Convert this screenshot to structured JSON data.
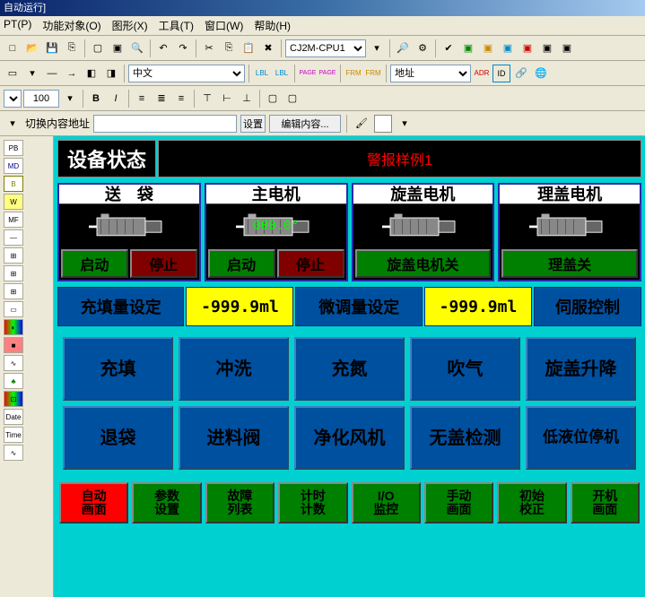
{
  "window_title": "自动运行]",
  "menu": {
    "pt": "PT(P)",
    "func_obj": "功能对象(O)",
    "graphic": "图形(X)",
    "tool": "工具(T)",
    "window": "窗口(W)",
    "help": "帮助(H)"
  },
  "toolbar1": {
    "cpu_model": "CJ2M-CPU1"
  },
  "toolbar2": {
    "language": "中文",
    "addr_label": "地址"
  },
  "toolbar3": {
    "font_size": "100",
    "bold": "B",
    "italic": "I"
  },
  "addr_bar": {
    "label": "切换内容地址",
    "set_btn": "设置",
    "edit_btn": "编辑内容..."
  },
  "side_labels": [
    "PB",
    "MD",
    "B",
    "W",
    "MF",
    "—",
    "⊞",
    "⊞",
    "⊞",
    "▭",
    "◐",
    "■",
    "∿",
    "♣",
    "⊡",
    "Date",
    "Time",
    "∿"
  ],
  "hmi": {
    "status_label": "设备状态",
    "alarm_text": "警报样例1",
    "motors": [
      {
        "title": "送　袋",
        "value": null,
        "buttons": [
          {
            "label": "启动",
            "color": "green"
          },
          {
            "label": "停止",
            "color": "red"
          }
        ]
      },
      {
        "title": "主电机",
        "value": "000.0°",
        "buttons": [
          {
            "label": "启动",
            "color": "green"
          },
          {
            "label": "停止",
            "color": "red"
          }
        ]
      },
      {
        "title": "旋盖电机",
        "value": null,
        "buttons": [
          {
            "label": "旋盖电机关",
            "color": "green"
          }
        ]
      },
      {
        "title": "理盖电机",
        "value": null,
        "buttons": [
          {
            "label": "理盖关",
            "color": "green"
          }
        ]
      }
    ],
    "settings": {
      "fill_label": "充填量设定",
      "fill_value": "-999.9ml",
      "trim_label": "微调量设定",
      "trim_value": "-999.9ml",
      "servo_label": "伺服控制"
    },
    "func_grid": [
      "充填",
      "冲洗",
      "充氮",
      "吹气",
      "旋盖升降",
      "退袋",
      "进料阀",
      "净化风机",
      "无盖检测",
      "低液位停机"
    ],
    "nav": [
      {
        "label": "自动\n画面",
        "color": "red"
      },
      {
        "label": "参数\n设置",
        "color": "green"
      },
      {
        "label": "故障\n列表",
        "color": "green"
      },
      {
        "label": "计时\n计数",
        "color": "green"
      },
      {
        "label": "I/O\n监控",
        "color": "green"
      },
      {
        "label": "手动\n画面",
        "color": "green"
      },
      {
        "label": "初始\n校正",
        "color": "green"
      },
      {
        "label": "开机\n画面",
        "color": "green"
      }
    ]
  }
}
